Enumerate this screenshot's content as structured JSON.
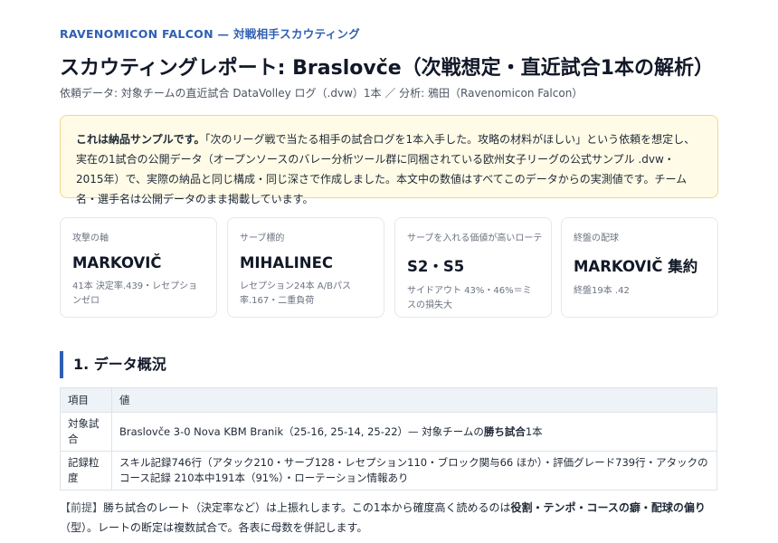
{
  "header": {
    "brand": "RAVENOMICON FALCON — 対戦相手スカウティング",
    "title": "スカウティングレポート: Braslovče（次戦想定・直近試合1本の解析）",
    "subtitle": "依頼データ: 対象チームの直近試合 DataVolley ログ（.dvw）1本 ／ 分析: 鴉田（Ravenomicon Falcon）"
  },
  "notice": {
    "lead": "これは納品サンプルです。",
    "body": "「次のリーグ戦で当たる相手の試合ログを1本入手した。攻略の材料がほしい」という依頼を想定し、実在の1試合の公開データ（オープンソースのバレー分析ツール群に同梱されている欧州女子リーグの公式サンプル .dvw・2015年）で、実際の納品と同じ構成・同じ深さで作成しました。本文中の数値はすべてこのデータからの実測値です。チーム名・選手名は公開データのまま掲載しています。"
  },
  "cards": [
    {
      "label": "攻撃の軸",
      "value": "MARKOVIČ",
      "note": "41本 決定率.439・レセプションゼロ"
    },
    {
      "label": "サーブ標的",
      "value": "MIHALINEC",
      "note": "レセプション24本 A/Bパス率.167・二重負荷"
    },
    {
      "label": "サーブを入れる価値が高いローテ",
      "value": "S2・S5",
      "note": "サイドアウト 43%・46%＝ミスの損失大"
    },
    {
      "label": "終盤の配球",
      "value": "MARKOVIČ 集約",
      "note": "終盤19本 .42"
    }
  ],
  "section1": {
    "title": "1. データ概況",
    "headers": [
      "項目",
      "値"
    ],
    "rows": [
      {
        "key": "対象試合",
        "value_pre": "Braslovče 3-0 Nova KBM Branik（25-16, 25-14, 25-22）— 対象チームの",
        "value_bold": "勝ち試合",
        "value_post": "1本"
      },
      {
        "key": "記録粒度",
        "value_pre": "スキル記録746行（アタック210・サーブ128・レセプション110・ブロック関与66 ほか）・評価グレード739行・アタックのコース記録 210本中191本（91%）・ローテーション情報あり",
        "value_bold": "",
        "value_post": ""
      }
    ]
  },
  "premise": {
    "tag": "【前提】",
    "text1": "勝ち試合のレート（決定率など）は上振れします。この1本から確度高く読めるのは",
    "bold": "役割・テンポ・コースの癖・配球の偏り",
    "text2": "（型）。レートの断定は複数試合で。各表に母数を併記します。"
  }
}
